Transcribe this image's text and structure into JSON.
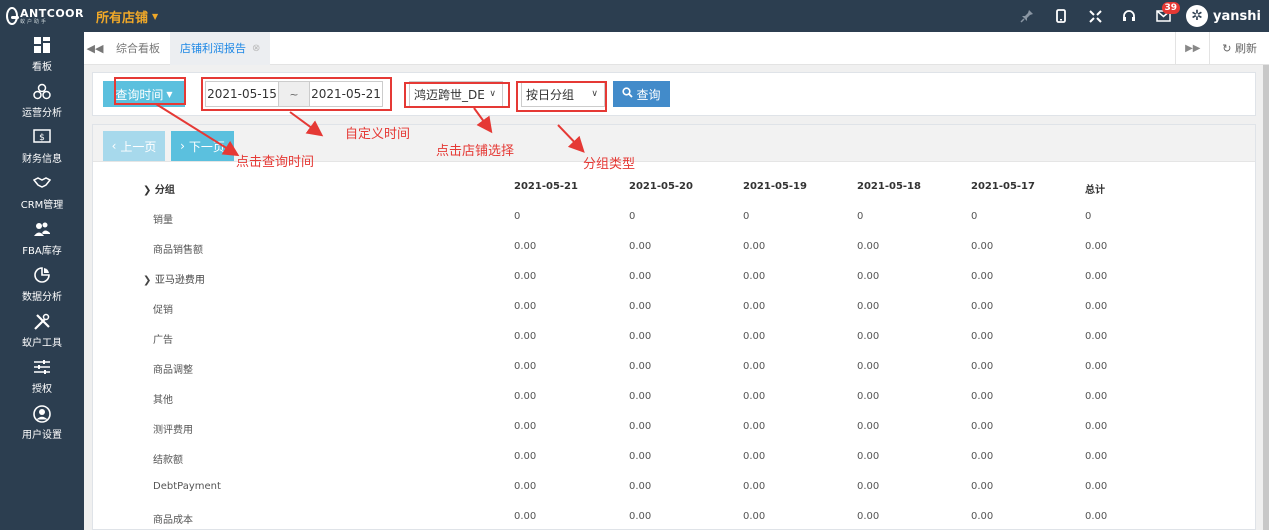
{
  "brand": {
    "name": "ANTCOOR",
    "sub": "蚁户助手"
  },
  "topbar": {
    "store_label": "所有店铺",
    "badge_count": "39",
    "username": "yanshi",
    "icons": [
      "pin-icon",
      "mobile-icon",
      "fullscreen-icon",
      "headset-icon",
      "mail-icon"
    ]
  },
  "sidebar": {
    "items": [
      {
        "label": "看板",
        "icon": "dashboard-icon"
      },
      {
        "label": "运营分析",
        "icon": "network-icon"
      },
      {
        "label": "财务信息",
        "icon": "money-icon"
      },
      {
        "label": "CRM管理",
        "icon": "handshake-icon"
      },
      {
        "label": "FBA库存",
        "icon": "users-icon"
      },
      {
        "label": "数据分析",
        "icon": "piechart-icon"
      },
      {
        "label": "蚁户工具",
        "icon": "tools-icon"
      },
      {
        "label": "授权",
        "icon": "sliders-icon"
      },
      {
        "label": "用户设置",
        "icon": "user-circle-icon"
      }
    ]
  },
  "tabs": {
    "items": [
      {
        "label": "综合看板",
        "active": false
      },
      {
        "label": "店铺利润报告",
        "active": true
      }
    ],
    "refresh_label": "刷新"
  },
  "filter": {
    "query_time_label": "查询时间",
    "date_start": "2021-05-15",
    "date_sep": "~",
    "date_end": "2021-05-21",
    "store_value": "鸿迈跨世_DE",
    "group_value": "按日分组",
    "search_label": "查询"
  },
  "pager": {
    "prev_label": "上一页",
    "next_label": "下一页"
  },
  "annotations": {
    "custom_time": "自定义时间",
    "click_query_time": "点击查询时间",
    "click_store": "点击店铺选择",
    "group_type": "分组类型"
  },
  "table": {
    "group_header": "分组",
    "columns": [
      "2021-05-21",
      "2021-05-20",
      "2021-05-19",
      "2021-05-18",
      "2021-05-17",
      "总计"
    ],
    "rows": [
      {
        "label": "销量",
        "expandable": false,
        "values": [
          "0",
          "0",
          "0",
          "0",
          "0",
          "0"
        ]
      },
      {
        "label": "商品销售额",
        "expandable": false,
        "values": [
          "0.00",
          "0.00",
          "0.00",
          "0.00",
          "0.00",
          "0.00"
        ]
      },
      {
        "label": "亚马逊费用",
        "expandable": true,
        "values": [
          "0.00",
          "0.00",
          "0.00",
          "0.00",
          "0.00",
          "0.00"
        ]
      },
      {
        "label": "促销",
        "expandable": false,
        "values": [
          "0.00",
          "0.00",
          "0.00",
          "0.00",
          "0.00",
          "0.00"
        ]
      },
      {
        "label": "广告",
        "expandable": false,
        "values": [
          "0.00",
          "0.00",
          "0.00",
          "0.00",
          "0.00",
          "0.00"
        ]
      },
      {
        "label": "商品调整",
        "expandable": false,
        "values": [
          "0.00",
          "0.00",
          "0.00",
          "0.00",
          "0.00",
          "0.00"
        ]
      },
      {
        "label": "其他",
        "expandable": false,
        "values": [
          "0.00",
          "0.00",
          "0.00",
          "0.00",
          "0.00",
          "0.00"
        ]
      },
      {
        "label": "测评费用",
        "expandable": false,
        "values": [
          "0.00",
          "0.00",
          "0.00",
          "0.00",
          "0.00",
          "0.00"
        ]
      },
      {
        "label": "结款额",
        "expandable": false,
        "values": [
          "0.00",
          "0.00",
          "0.00",
          "0.00",
          "0.00",
          "0.00"
        ]
      },
      {
        "label": "DebtPayment",
        "expandable": false,
        "values": [
          "0.00",
          "0.00",
          "0.00",
          "0.00",
          "0.00",
          "0.00"
        ]
      },
      {
        "label": "商品成本",
        "expandable": false,
        "values": [
          "0.00",
          "0.00",
          "0.00",
          "0.00",
          "0.00",
          "0.00"
        ]
      }
    ]
  }
}
